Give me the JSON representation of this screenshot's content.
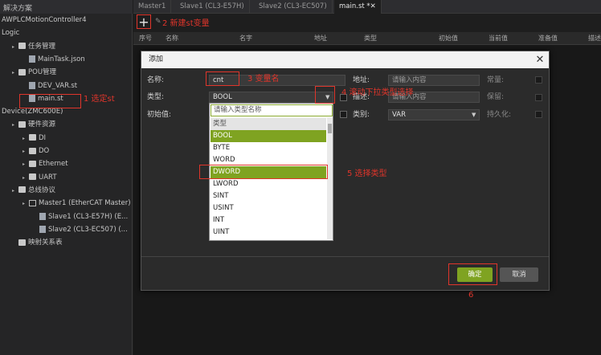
{
  "left_panel": {
    "title": "解决方案",
    "items": [
      {
        "label": "AWPLCMotionController4",
        "indent": 0
      },
      {
        "label": "Logic",
        "indent": 0
      },
      {
        "label": "任务管理",
        "indent": 1
      },
      {
        "label": "MainTask.json",
        "indent": 2
      },
      {
        "label": "POU管理",
        "indent": 1
      },
      {
        "label": "DEV_VAR.st",
        "indent": 2
      },
      {
        "label": "main.st",
        "indent": 2
      },
      {
        "label": "Device(ZMC600E)",
        "indent": 0
      },
      {
        "label": "硬件资源",
        "indent": 1
      },
      {
        "label": "DI",
        "indent": 2
      },
      {
        "label": "DO",
        "indent": 2
      },
      {
        "label": "Ethernet",
        "indent": 2
      },
      {
        "label": "UART",
        "indent": 2
      },
      {
        "label": "总线协议",
        "indent": 1
      },
      {
        "label": "Master1 (EtherCAT Master)",
        "indent": 2
      },
      {
        "label": "Slave1 (CL3-E57H) (E...",
        "indent": 3
      },
      {
        "label": "Slave2 (CL3-EC507) (...",
        "indent": 3
      },
      {
        "label": "映射关系表",
        "indent": 1
      }
    ]
  },
  "tabs": [
    {
      "label": "Master1"
    },
    {
      "label": "Slave1 (CL3-E57H)"
    },
    {
      "label": "Slave2 (CL3-EC507)"
    },
    {
      "label": "main.st *✕"
    }
  ],
  "table_headers": [
    "序号",
    "名称",
    "名字",
    "地址",
    "类型",
    "初始值",
    "当前值",
    "准备值",
    "描述"
  ],
  "dialog": {
    "title": "添加",
    "close": "✕",
    "name_label": "名称:",
    "name_value": "cnt",
    "type_label": "类型:",
    "type_value": "BOOL",
    "init_label": "初始值:",
    "address_label": "地址:",
    "address_placeholder": "请输入内容",
    "const_label": "常量:",
    "desc_label": "描述:",
    "desc_placeholder": "请输入内容",
    "retain_label": "保留:",
    "category_label": "类别:",
    "category_value": "VAR",
    "persist_label": "持久化:",
    "ok": "确定",
    "cancel": "取消"
  },
  "dropdown": {
    "search_placeholder": "请输入类型名称",
    "group": "类型",
    "items": [
      "BOOL",
      "BYTE",
      "WORD",
      "DWORD",
      "LWORD",
      "SINT",
      "USINT",
      "INT",
      "UINT"
    ],
    "highlighted": [
      "BOOL",
      "DWORD"
    ]
  },
  "annotations": {
    "a1": "1 选定st",
    "a2": "2 新建st变量",
    "a3": "3 变量名",
    "a4": "4 滚动下拉类型选择",
    "a5": "5 选择类型",
    "a6": "6"
  },
  "colors": {
    "accent": "#7fa321",
    "annotation": "#e0352b"
  }
}
